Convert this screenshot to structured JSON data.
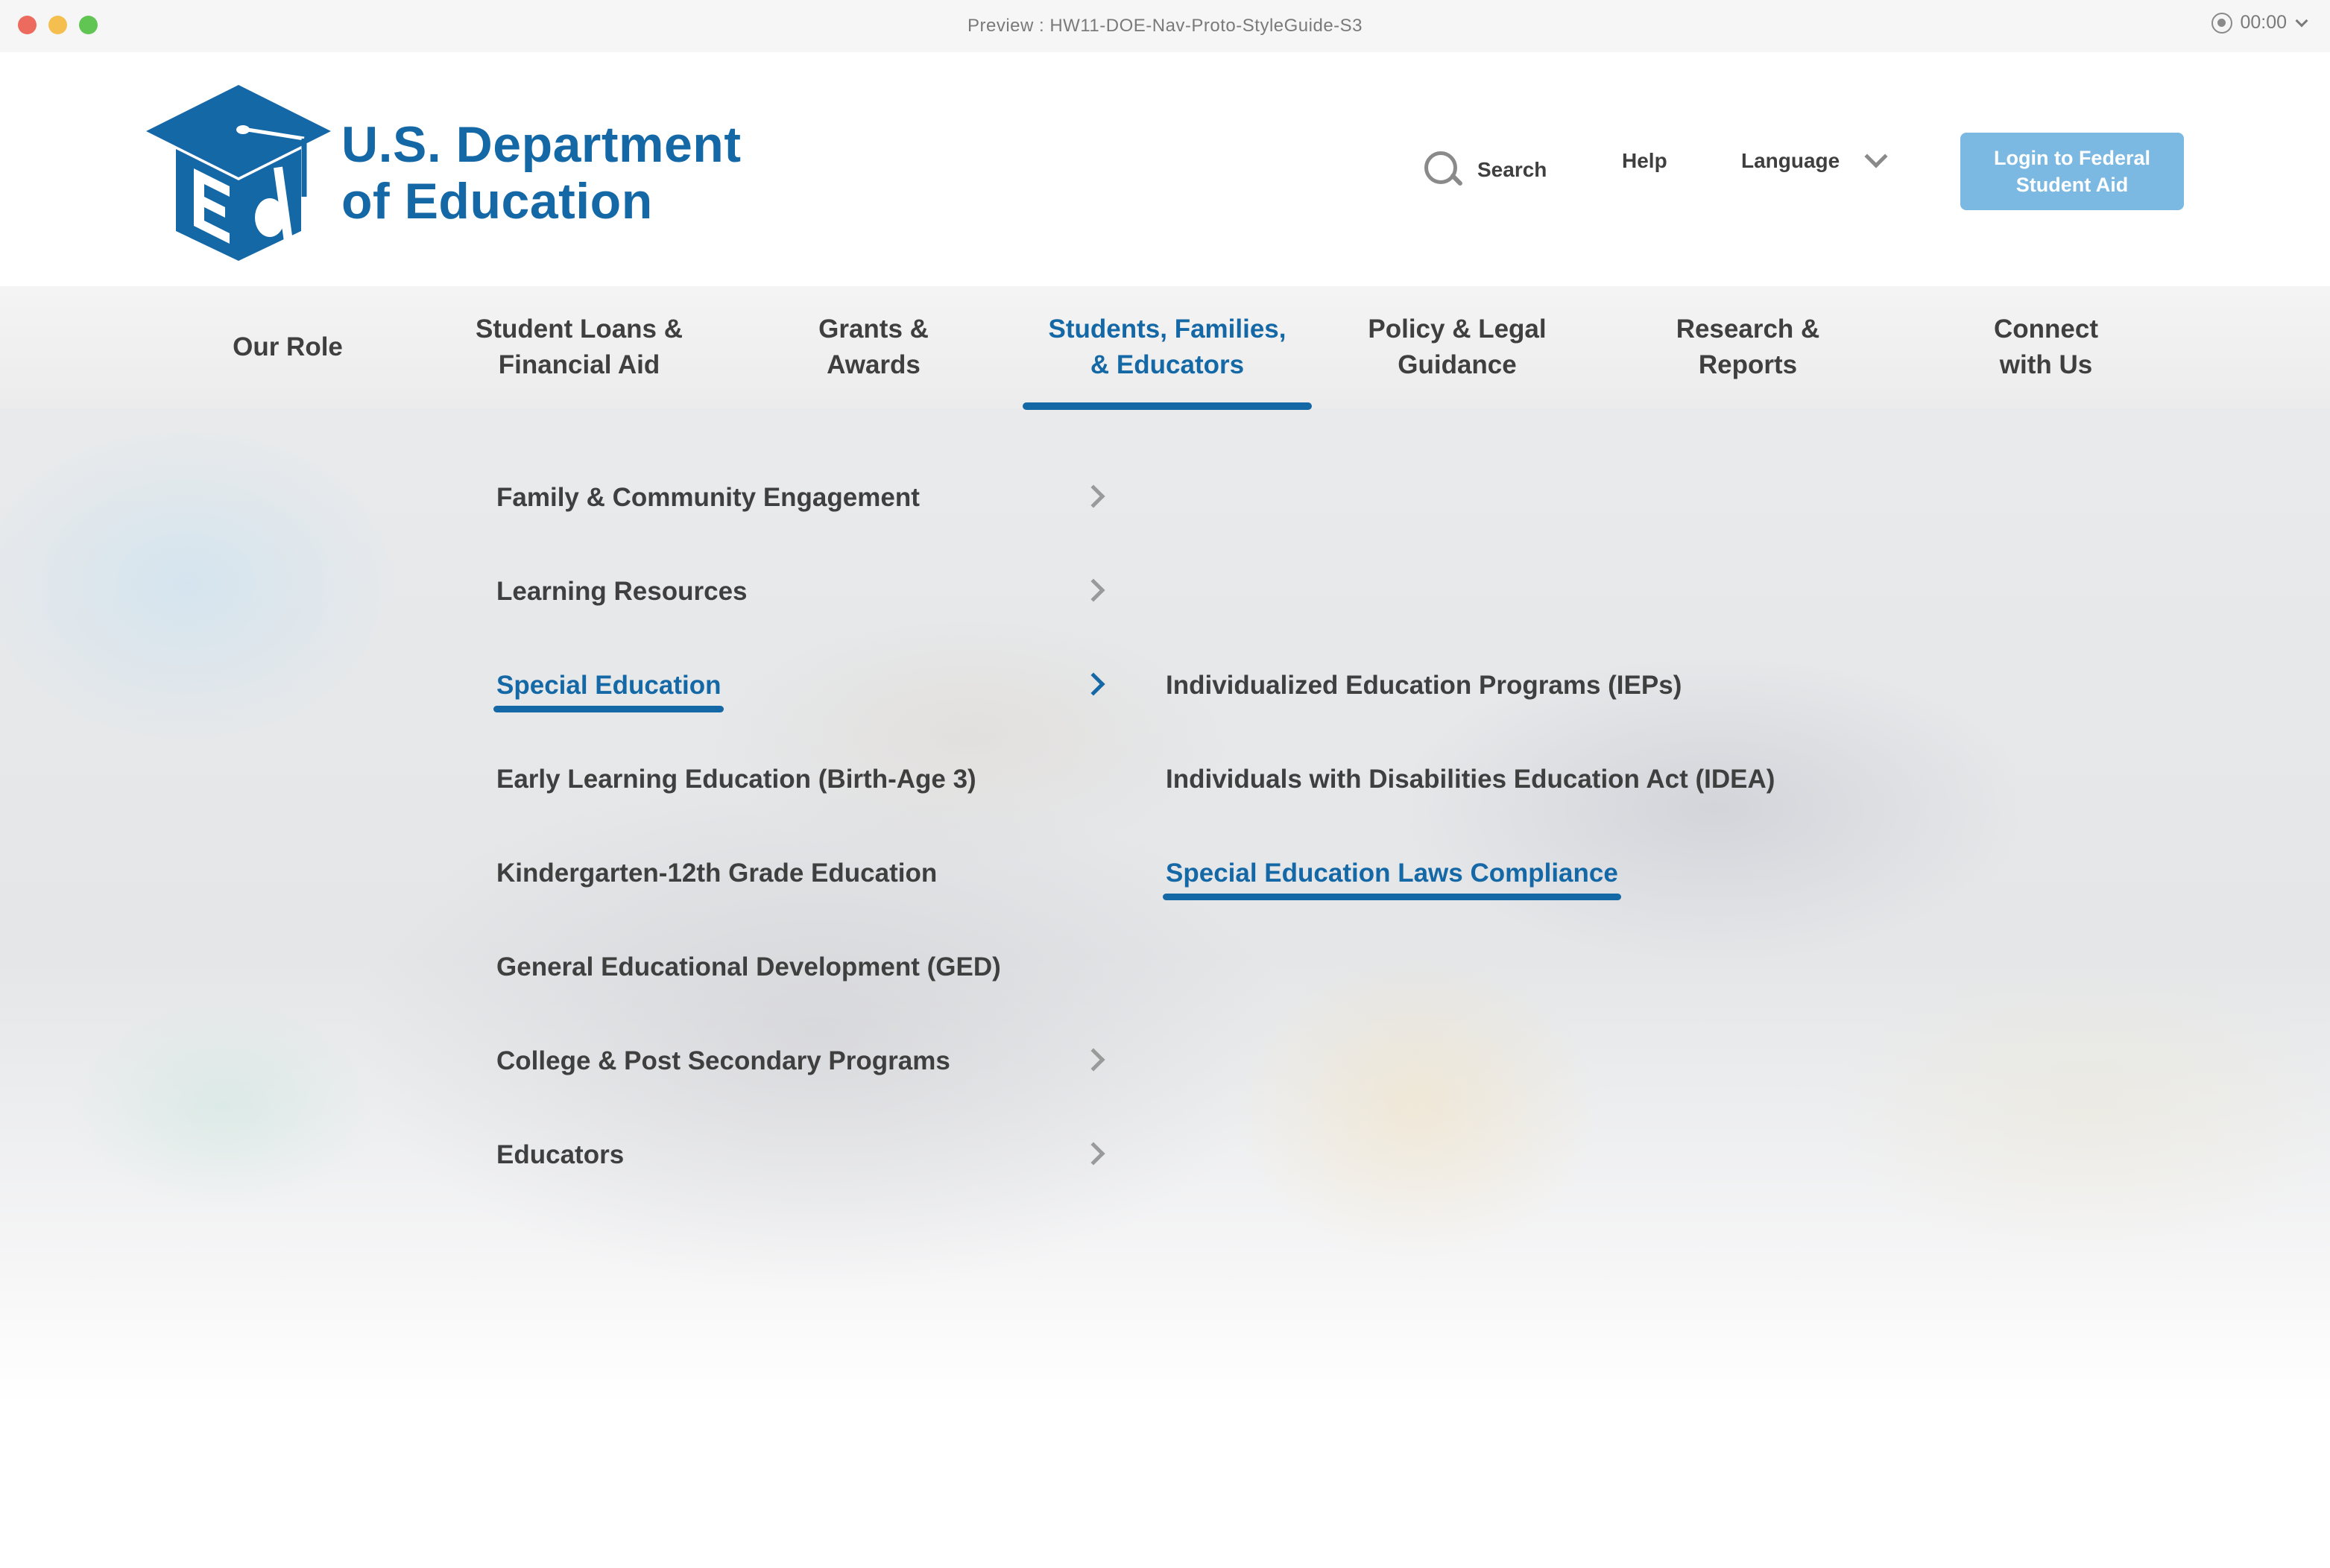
{
  "window": {
    "title": "Preview : HW11-DOE-Nav-Proto-StyleGuide-S3",
    "timer": "00:00"
  },
  "header": {
    "logo_line1": "U.S. Department",
    "logo_line2": "of Education",
    "search_label": "Search",
    "help_label": "Help",
    "language_label": "Language",
    "login_label": "Login to Federal Student Aid",
    "colors": {
      "brand": "#1568a6",
      "login_button": "#7bb9e3",
      "text": "#3f3f3f"
    }
  },
  "nav": {
    "items": [
      {
        "label": "Our Role"
      },
      {
        "label": "Student Loans &\nFinancial Aid"
      },
      {
        "label": "Grants &\nAwards"
      },
      {
        "label": "Students, Families,\n& Educators",
        "active": true
      },
      {
        "label": "Policy & Legal\nGuidance"
      },
      {
        "label": "Research &\nReports"
      },
      {
        "label": "Connect\nwith Us"
      }
    ]
  },
  "menu": {
    "items": [
      {
        "label": "Family & Community Engagement",
        "has_submenu": true
      },
      {
        "label": "Learning Resources",
        "has_submenu": true
      },
      {
        "label": "Special Education",
        "has_submenu": true,
        "active": true
      },
      {
        "label": "Early Learning Education (Birth-Age 3)",
        "has_submenu": false
      },
      {
        "label": "Kindergarten-12th Grade Education",
        "has_submenu": false
      },
      {
        "label": "General Educational Development (GED)",
        "has_submenu": false
      },
      {
        "label": "College & Post Secondary Programs",
        "has_submenu": true
      },
      {
        "label": "Educators",
        "has_submenu": true
      }
    ]
  },
  "submenu": {
    "items": [
      {
        "label": "Individualized Education Programs (IEPs)"
      },
      {
        "label": "Individuals with Disabilities Education Act (IDEA)"
      },
      {
        "label": "Special Education Laws Compliance",
        "active": true
      }
    ]
  }
}
